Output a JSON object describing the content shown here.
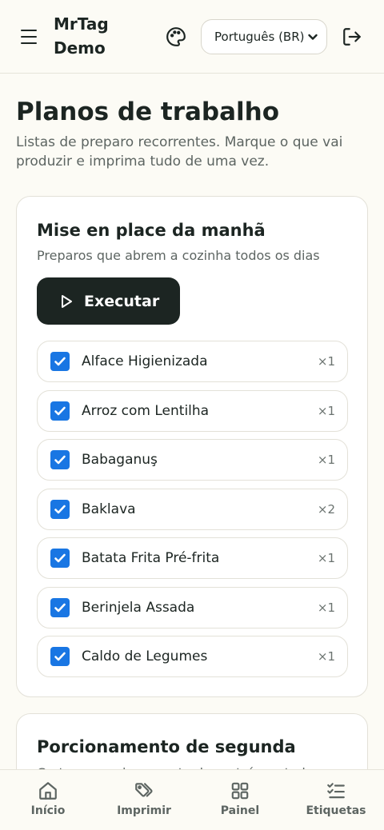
{
  "header": {
    "brand_line1": "MrTag",
    "brand_line2": "Demo",
    "language": "Português (BR)"
  },
  "page": {
    "title": "Planos de trabalho",
    "subtitle": "Listas de preparo recorrentes. Marque o que vai produzir e imprima tudo de uma vez."
  },
  "plans": [
    {
      "title": "Mise en place da manhã",
      "subtitle": "Preparos que abrem a cozinha todos os dias",
      "run_label": "Executar",
      "items": [
        {
          "name": "Alface Higienizada",
          "qty": "×1",
          "checked": true
        },
        {
          "name": "Arroz com Lentilha",
          "qty": "×1",
          "checked": true
        },
        {
          "name": "Babaganuş",
          "qty": "×1",
          "checked": true
        },
        {
          "name": "Baklava",
          "qty": "×2",
          "checked": true
        },
        {
          "name": "Batata Frita Pré-frita",
          "qty": "×1",
          "checked": true
        },
        {
          "name": "Berinjela Assada",
          "qty": "×1",
          "checked": true
        },
        {
          "name": "Caldo de Legumes",
          "qty": "×1",
          "checked": true
        }
      ]
    },
    {
      "title": "Porcionamento de segunda",
      "subtitle": "Cortes e porcionamento da proteína e todas"
    }
  ],
  "nav": [
    {
      "label": "Início",
      "icon": "home-icon"
    },
    {
      "label": "Imprimir",
      "icon": "tags-icon"
    },
    {
      "label": "Painel",
      "icon": "grid-icon"
    },
    {
      "label": "Etiquetas",
      "icon": "checklist-icon"
    }
  ],
  "colors": {
    "accent": "#1976e3",
    "dark": "#1c2522",
    "background": "#fcfbf5"
  }
}
